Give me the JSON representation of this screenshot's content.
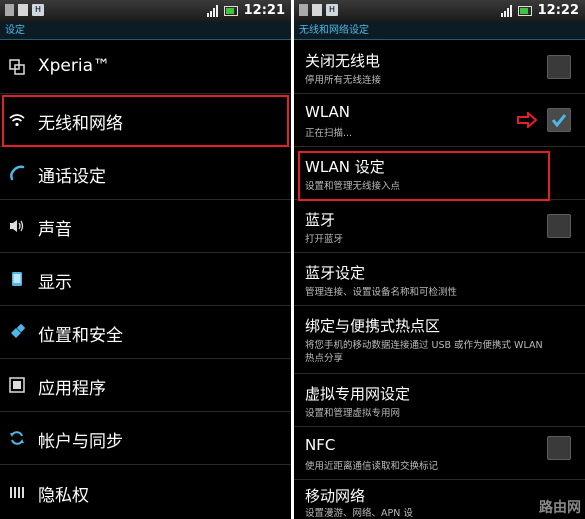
{
  "left": {
    "status": {
      "badge": "H",
      "time": "12:21"
    },
    "title": "设定",
    "items": [
      {
        "label": "Xperia™",
        "icon": "xperia-icon"
      },
      {
        "label": "无线和网络",
        "icon": "wifi-icon"
      },
      {
        "label": "通话设定",
        "icon": "phone-icon"
      },
      {
        "label": "声音",
        "icon": "speaker-icon"
      },
      {
        "label": "显示",
        "icon": "display-icon"
      },
      {
        "label": "位置和安全",
        "icon": "location-security-icon"
      },
      {
        "label": "应用程序",
        "icon": "applications-icon"
      },
      {
        "label": "帐户与同步",
        "icon": "sync-icon"
      },
      {
        "label": "隐私权",
        "icon": "privacy-icon"
      }
    ]
  },
  "right": {
    "status": {
      "badge": "H",
      "time": "12:22"
    },
    "title": "无线和网络设定",
    "items": [
      {
        "title": "关闭无线电",
        "subtitle": "停用所有无线连接",
        "checkbox": "unchecked"
      },
      {
        "title": "WLAN",
        "subtitle": "正在扫描...",
        "checkbox": "checked"
      },
      {
        "title": "WLAN 设定",
        "subtitle": "设置和管理无线接入点",
        "checkbox": "none"
      },
      {
        "title": "蓝牙",
        "subtitle": "打开蓝牙",
        "checkbox": "unchecked"
      },
      {
        "title": "蓝牙设定",
        "subtitle": "管理连接、设置设备名称和可检测性",
        "checkbox": "none"
      },
      {
        "title": "绑定与便携式热点区",
        "subtitle": "将您手机的移动数据连接通过 USB 或作为便携式 WLAN 热点分享",
        "checkbox": "none"
      },
      {
        "title": "虚拟专用网设定",
        "subtitle": "设置和管理虚拟专用网",
        "checkbox": "none"
      },
      {
        "title": "NFC",
        "subtitle": "使用近距离通信读取和交换标记",
        "checkbox": "unchecked"
      },
      {
        "title": "移动网络",
        "subtitle": "设置漫游、网络、APN 设",
        "checkbox": "none"
      }
    ]
  },
  "watermark": "路由网",
  "colors": {
    "highlight": "#e0212b",
    "accent": "#4fb7e6"
  }
}
